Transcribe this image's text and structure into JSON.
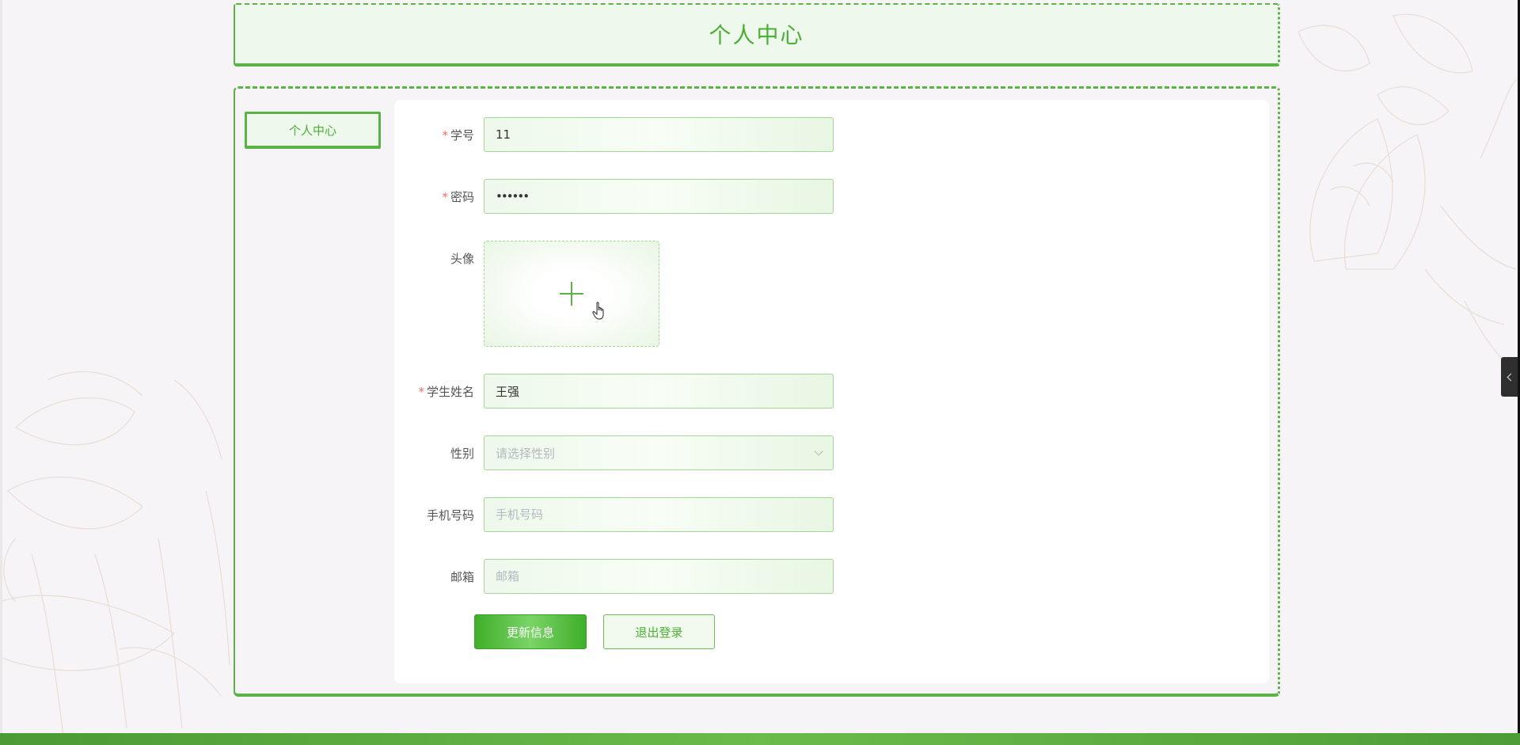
{
  "header": {
    "title": "个人中心"
  },
  "sidebar": {
    "items": [
      {
        "label": "个人中心",
        "active": true
      }
    ]
  },
  "form": {
    "student_id": {
      "label": "学号",
      "required": true,
      "value": "11"
    },
    "password": {
      "label": "密码",
      "required": true,
      "value": "••••••"
    },
    "avatar": {
      "label": "头像",
      "icon": "plus-icon"
    },
    "student_name": {
      "label": "学生姓名",
      "required": true,
      "value": "王强"
    },
    "gender": {
      "label": "性别",
      "placeholder": "请选择性别",
      "icon": "chevron-down-icon"
    },
    "phone": {
      "label": "手机号码",
      "placeholder": "手机号码"
    },
    "email": {
      "label": "邮箱",
      "placeholder": "邮箱"
    },
    "required_mark": "*"
  },
  "actions": {
    "update_label": "更新信息",
    "logout_label": "退出登录"
  },
  "colors": {
    "accent": "#5cb345",
    "accent_text": "#4caf36",
    "required": "#f56c6c",
    "bottom_bar": "#5aa93f"
  }
}
